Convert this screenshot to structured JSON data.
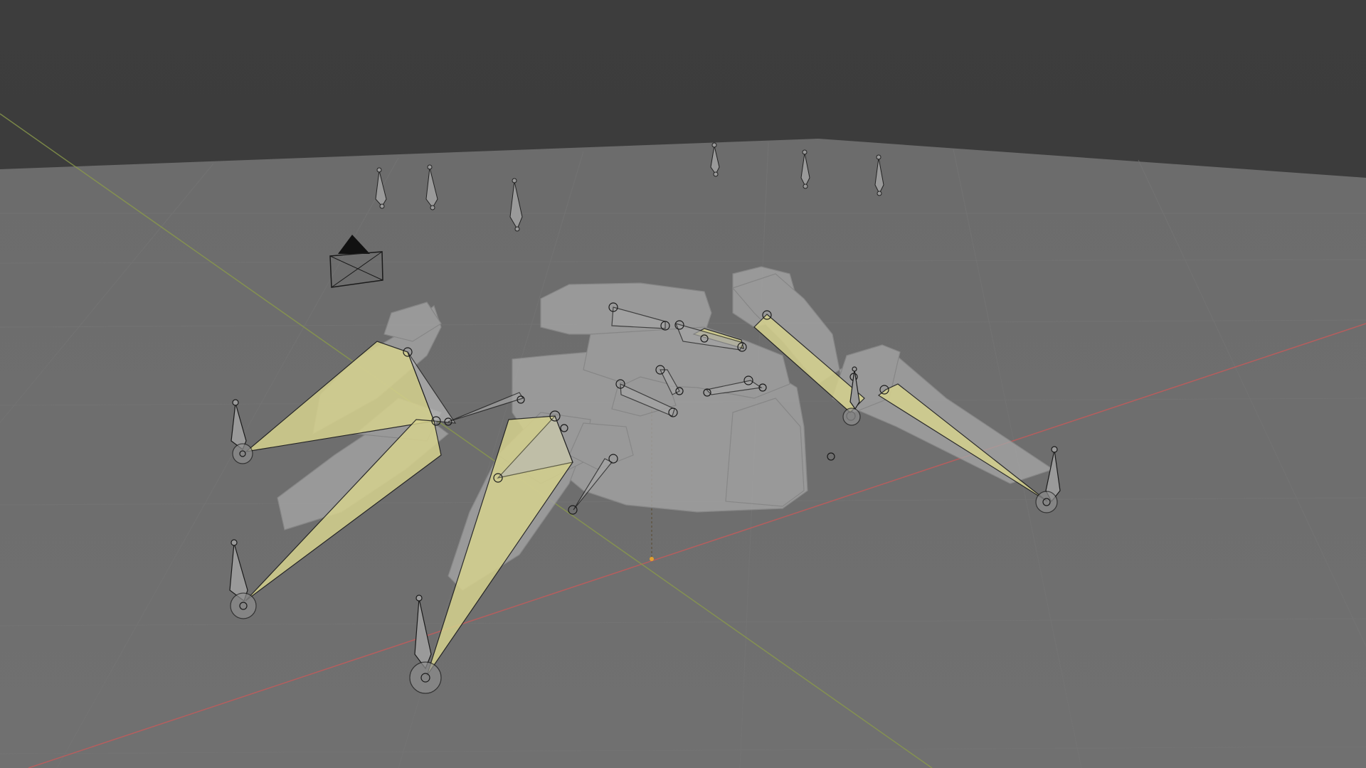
{
  "viewport": {
    "background_color": "#3a3a3a",
    "floor_color": "#6e6e6e",
    "grid_color": "#777777",
    "x_axis_color": "#c85a5a",
    "y_axis_color": "#8a9a4a",
    "bone_selected_color": "#d6d28e",
    "bone_color": "#9a9a9a",
    "bone_outline_color": "#1a1a1a",
    "mesh_color": "#a6a6a6",
    "origin_color": "#e0a030",
    "camera_color": "#111111"
  },
  "scene": {
    "objects": [
      {
        "name": "spider-mesh",
        "type": "mesh"
      },
      {
        "name": "spider-armature",
        "type": "armature"
      },
      {
        "name": "camera",
        "type": "camera"
      },
      {
        "name": "ik-control-bones",
        "type": "bone-group"
      }
    ]
  }
}
